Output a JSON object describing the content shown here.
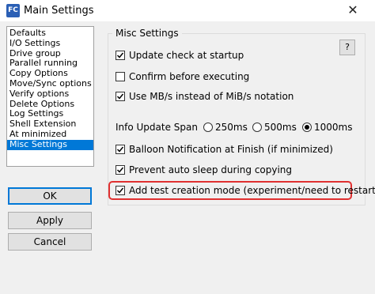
{
  "window": {
    "app_icon_text": "FC",
    "title": "Main Settings",
    "close_glyph": "✕"
  },
  "sidebar": {
    "items": [
      {
        "label": "Defaults"
      },
      {
        "label": "I/O Settings"
      },
      {
        "label": "Drive group"
      },
      {
        "label": "Parallel running"
      },
      {
        "label": "Copy Options"
      },
      {
        "label": "Move/Sync options"
      },
      {
        "label": "Verify options"
      },
      {
        "label": "Delete Options"
      },
      {
        "label": "Log Settings"
      },
      {
        "label": "Shell Extension"
      },
      {
        "label": "At minimized"
      },
      {
        "label": "Misc Settings",
        "selected": true
      }
    ]
  },
  "buttons": {
    "ok": "OK",
    "apply": "Apply",
    "cancel": "Cancel"
  },
  "group": {
    "title": "Misc Settings",
    "help_label": "?"
  },
  "options": {
    "update_check": {
      "label": "Update check at startup",
      "checked": true
    },
    "confirm_execute": {
      "label": "Confirm before executing",
      "checked": false
    },
    "use_mb": {
      "label": "Use MB/s instead of MiB/s notation",
      "checked": true
    },
    "info_update_span": {
      "label": "Info Update Span",
      "choices": [
        "250ms",
        "500ms",
        "1000ms"
      ],
      "selected": "1000ms"
    },
    "balloon": {
      "label": "Balloon Notification at Finish (if minimized)",
      "checked": true
    },
    "prevent_sleep": {
      "label": "Prevent auto sleep during copying",
      "checked": true
    },
    "test_mode": {
      "label": "Add test creation mode (experiment/need to restart)",
      "checked": true
    }
  },
  "colors": {
    "selection": "#0078d7",
    "highlight_border": "#e03030"
  }
}
